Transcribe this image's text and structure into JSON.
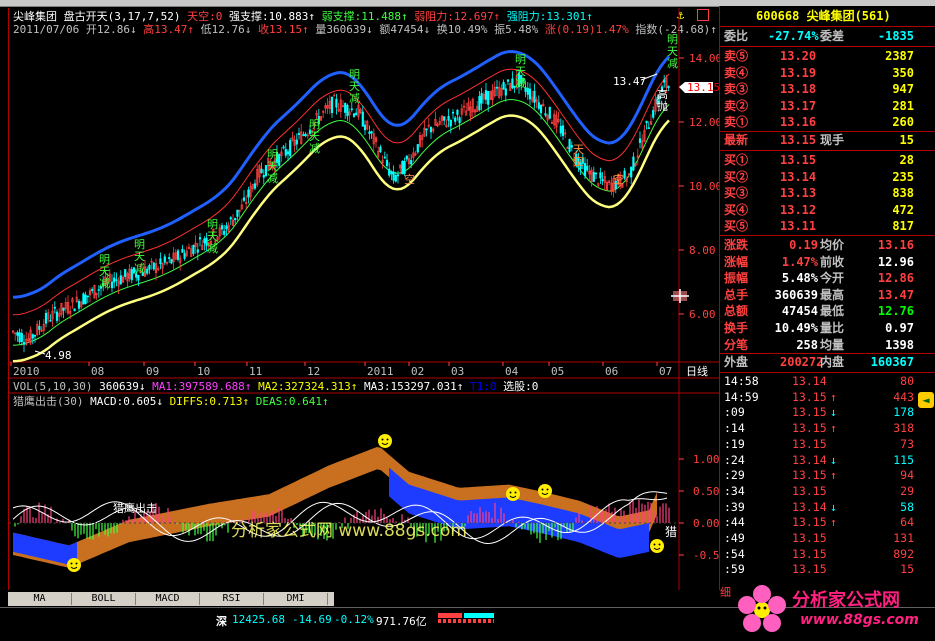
{
  "header": {
    "stock_name": "尖峰集团",
    "indicator_name": "盘古开天(3,17,7,52)",
    "tiankong_label": "天空:0",
    "strong_support": "强支撑:10.883↑",
    "weak_support": "弱支撑:11.488↑",
    "weak_resist": "弱阻力:12.697↑",
    "strong_resist": "强阻力:13.301↑",
    "date": "2011/07/06",
    "open": "开12.86↓",
    "high": "高13.47↑",
    "low": "低12.76↓",
    "close": "收13.15↑",
    "volume": "量360639↓",
    "amount": "额47454↓",
    "turnover": "换10.49%",
    "amplitude": "振5.48%",
    "change": "涨(0.19)1.47%",
    "index": "指数(-24.68)↑",
    "lock_label": "🔒",
    "window_tag": "□"
  },
  "price_axis": {
    "ticks": [
      "14.00",
      "12.00",
      "10.00",
      "8.00",
      "6.00"
    ],
    "current_price": "13.15",
    "high_mark": "13.47",
    "low_mark": "4.98"
  },
  "time_axis": {
    "labels": [
      "2010",
      "08",
      "09",
      "10",
      "11",
      "12",
      "2011",
      "02",
      "03",
      "04",
      "05",
      "06",
      "07"
    ],
    "period": "日线"
  },
  "chart_labels": {
    "ming": "明天减",
    "jin": "进场",
    "gao": "高抛",
    "tian": "天空",
    "juebai": "绝",
    "kong": "空"
  },
  "volume_header": {
    "name": "VOL(5,10,30)",
    "vol": "360639↓",
    "ma1": "MA1:397589.688↑",
    "ma2": "MA2:327324.313↑",
    "ma3": "MA3:153297.031↑",
    "t1": "T1:0",
    "xuangu": "选股:0"
  },
  "macd_header": {
    "name": "猎鹰出击(30)",
    "macd": "MACD:0.605↓",
    "diffs": "DIFFS:0.713↑",
    "deas": "DEAS:0.641↑"
  },
  "macd_axis": {
    "ticks": [
      "1.00",
      "0.50",
      "0.00",
      "-0.50"
    ],
    "annotation": "猎鹰出击",
    "end_label": "猎"
  },
  "watermark": {
    "text": "分析家公式网 www.88gs.com"
  },
  "right_panel": {
    "code_title": "600668 尖峰集团(561)",
    "weibi_label": "委比",
    "weibi_value": "-27.74%",
    "weicha_label": "委差",
    "weicha_value": "-1835",
    "asks": [
      {
        "label": "卖⑤",
        "price": "13.20",
        "vol": "2387"
      },
      {
        "label": "卖④",
        "price": "13.19",
        "vol": "350"
      },
      {
        "label": "卖③",
        "price": "13.18",
        "vol": "947"
      },
      {
        "label": "卖②",
        "price": "13.17",
        "vol": "281"
      },
      {
        "label": "卖①",
        "price": "13.16",
        "vol": "260"
      }
    ],
    "latest_label": "最新",
    "latest_price": "13.15",
    "xianshou_label": "现手",
    "xianshou_value": "15",
    "bids": [
      {
        "label": "买①",
        "price": "13.15",
        "vol": "28"
      },
      {
        "label": "买②",
        "price": "13.14",
        "vol": "235"
      },
      {
        "label": "买③",
        "price": "13.13",
        "vol": "838"
      },
      {
        "label": "买④",
        "price": "13.12",
        "vol": "472"
      },
      {
        "label": "买⑤",
        "price": "13.11",
        "vol": "817"
      }
    ],
    "stats": [
      {
        "l1": "涨跌",
        "v1": "0.19",
        "l2": "均价",
        "v2": "13.16"
      },
      {
        "l1": "涨幅",
        "v1": "1.47%",
        "l2": "前收",
        "v2": "12.96"
      },
      {
        "l1": "振幅",
        "v1": "5.48%",
        "l2": "今开",
        "v2": "12.86"
      },
      {
        "l1": "总手",
        "v1": "360639",
        "l2": "最高",
        "v2": "13.47"
      },
      {
        "l1": "总额",
        "v1": "47454",
        "l2": "最低",
        "v2": "12.76"
      },
      {
        "l1": "换手",
        "v1": "10.49%",
        "l2": "量比",
        "v2": "0.97"
      },
      {
        "l1": "分笔",
        "v1": "258",
        "l2": "均量",
        "v2": "1398"
      }
    ],
    "waipan_label": "外盘",
    "waipan_value": "200272",
    "neipan_label": "内盘",
    "neipan_value": "160367",
    "ticks": [
      {
        "t": "14:58",
        "p": "13.14",
        "v": "80",
        "a": ""
      },
      {
        "t": "14:59",
        "p": "13.15",
        "v": "443",
        "a": "↑"
      },
      {
        "t": ":09",
        "p": "13.15",
        "v": "178",
        "a": "↓"
      },
      {
        "t": ":14",
        "p": "13.15",
        "v": "318",
        "a": "↑"
      },
      {
        "t": ":19",
        "p": "13.15",
        "v": "73",
        "a": ""
      },
      {
        "t": ":24",
        "p": "13.14",
        "v": "115",
        "a": "↓"
      },
      {
        "t": ":29",
        "p": "13.15",
        "v": "94",
        "a": "↑"
      },
      {
        "t": ":34",
        "p": "13.15",
        "v": "29",
        "a": ""
      },
      {
        "t": ":39",
        "p": "13.14",
        "v": "58",
        "a": "↓"
      },
      {
        "t": ":44",
        "p": "13.15",
        "v": "64",
        "a": "↑"
      },
      {
        "t": ":49",
        "p": "13.15",
        "v": "131",
        "a": ""
      },
      {
        "t": ":54",
        "p": "13.15",
        "v": "892",
        "a": ""
      },
      {
        "t": ":59",
        "p": "13.15",
        "v": "15",
        "a": ""
      }
    ],
    "fen_label": "细"
  },
  "tabs": [
    "MA",
    "BOLL",
    "MACD",
    "RSI",
    "DMI"
  ],
  "status_bar": {
    "market": "深",
    "index_value": "12425.68",
    "index_change": "-14.69",
    "index_pct": "-0.12%",
    "turnover": "971.76亿"
  },
  "logo": {
    "text": "分析家公式网",
    "url_text": "www.88gs.com"
  },
  "colors": {
    "up": "#ff4040",
    "down": "#00ffff",
    "yellow": "#ffff00",
    "border": "#b00000",
    "blue_band": "#1e4bff",
    "orange_band": "#c87020"
  }
}
